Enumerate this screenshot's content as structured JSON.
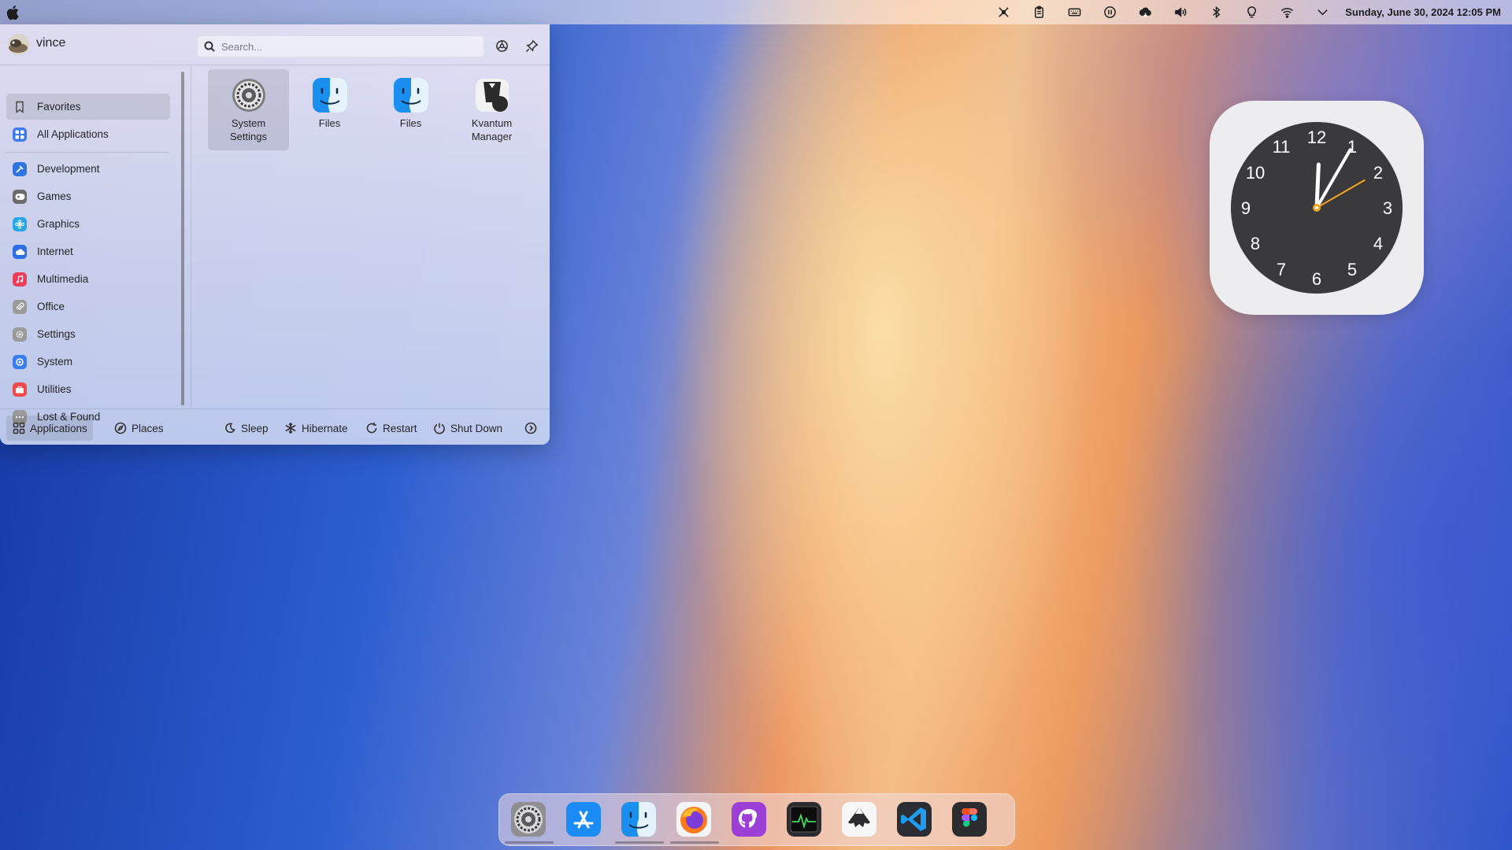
{
  "menubar": {
    "datetime": "Sunday, June 30, 2024 12:05 PM",
    "tray_icons": [
      "kde-connect-icon",
      "clipboard-icon",
      "keyboard-icon",
      "pause-icon",
      "cloud-icon",
      "volume-icon",
      "bluetooth-icon",
      "lightbulb-icon",
      "wifi-icon",
      "chevron-down-icon"
    ]
  },
  "launcher": {
    "username": "vince",
    "search_placeholder": "Search...",
    "sidebar": {
      "items": [
        {
          "label": "Favorites",
          "icon": "bookmark-icon",
          "color": "#5a5a5a"
        },
        {
          "label": "All Applications",
          "icon": "grid-icon",
          "color": "#3d7bf4"
        },
        {
          "label": "Development",
          "icon": "hammer-icon",
          "color": "#2f74e0"
        },
        {
          "label": "Games",
          "icon": "gamepad-icon",
          "color": "#6a6a6a"
        },
        {
          "label": "Graphics",
          "icon": "flower-icon",
          "color": "#28a6e8"
        },
        {
          "label": "Internet",
          "icon": "cloud-icon",
          "color": "#2f6fe6"
        },
        {
          "label": "Multimedia",
          "icon": "music-icon",
          "color": "#ec3d5a"
        },
        {
          "label": "Office",
          "icon": "paperclip-icon",
          "color": "#8a8a8a"
        },
        {
          "label": "Settings",
          "icon": "gear-icon",
          "color": "#8a8a8a"
        },
        {
          "label": "System",
          "icon": "system-icon",
          "color": "#3a7df0"
        },
        {
          "label": "Utilities",
          "icon": "toolbox-icon",
          "color": "#ef4b4b"
        },
        {
          "label": "Lost & Found",
          "icon": "ellipsis-icon",
          "color": "#8a8a8a"
        }
      ]
    },
    "apps": [
      {
        "name": "System\nSettings",
        "icon": "system-settings-icon"
      },
      {
        "name": "Files",
        "icon": "finder-icon"
      },
      {
        "name": "Files",
        "icon": "finder-icon"
      },
      {
        "name": "Kvantum\nManager",
        "icon": "kvantum-icon"
      }
    ],
    "footer": {
      "applications": "Applications",
      "places": "Places",
      "sleep": "Sleep",
      "hibernate": "Hibernate",
      "restart": "Restart",
      "shutdown": "Shut Down"
    }
  },
  "clock_widget": {
    "numbers": [
      "12",
      "1",
      "2",
      "3",
      "4",
      "5",
      "6",
      "7",
      "8",
      "9",
      "10",
      "11"
    ],
    "time": "12:05"
  },
  "dock": {
    "items": [
      "system-settings-icon",
      "app-store-icon",
      "finder-icon",
      "firefox-icon",
      "github-icon",
      "activity-monitor-icon",
      "inkscape-icon",
      "vscode-icon",
      "figma-icon"
    ]
  }
}
